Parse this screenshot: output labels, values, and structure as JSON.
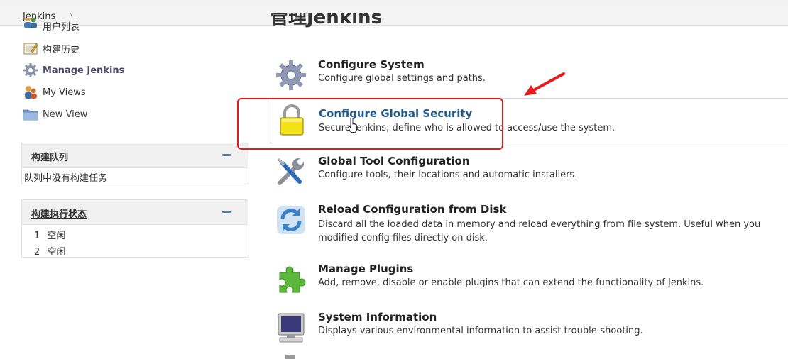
{
  "breadcrumb": {
    "root": "Jenkins",
    "separator": "›"
  },
  "sidebar": {
    "items": [
      {
        "label": "用户列表",
        "icon": "users-icon"
      },
      {
        "label": "构建历史",
        "icon": "notepad-icon"
      },
      {
        "label": "Manage Jenkins",
        "icon": "gear-icon"
      },
      {
        "label": "My Views",
        "icon": "user-icon"
      },
      {
        "label": "New View",
        "icon": "folder-icon"
      }
    ]
  },
  "build_queue": {
    "title": "构建队列",
    "empty_text": "队列中没有构建任务"
  },
  "executor_status": {
    "title": "构建执行状态",
    "executors": [
      {
        "number": "1",
        "state": "空闲"
      },
      {
        "number": "2",
        "state": "空闲"
      }
    ]
  },
  "main": {
    "page_title": "管理Jenkins",
    "entries": [
      {
        "title": "Configure System",
        "description": "Configure global settings and paths.",
        "icon": "gear-icon"
      },
      {
        "title": "Configure Global Security",
        "description": "Secure Jenkins; define who is allowed to access/use the system.",
        "icon": "lock-icon"
      },
      {
        "title": "Global Tool Configuration",
        "description": "Configure tools, their locations and automatic installers.",
        "icon": "wrench-screwdriver-icon"
      },
      {
        "title": "Reload Configuration from Disk",
        "description": "Discard all the loaded data in memory and reload everything from file system. Useful when you modified config files directly on disk.",
        "icon": "reload-icon"
      },
      {
        "title": "Manage Plugins",
        "description": "Add, remove, disable or enable plugins that can extend the functionality of Jenkins.",
        "icon": "puzzle-icon"
      },
      {
        "title": "System Information",
        "description": "Displays various environmental information to assist trouble-shooting.",
        "icon": "computer-icon"
      }
    ]
  },
  "colors": {
    "annotation_red": "#e8191c",
    "link_blue": "#1f5a8a"
  }
}
